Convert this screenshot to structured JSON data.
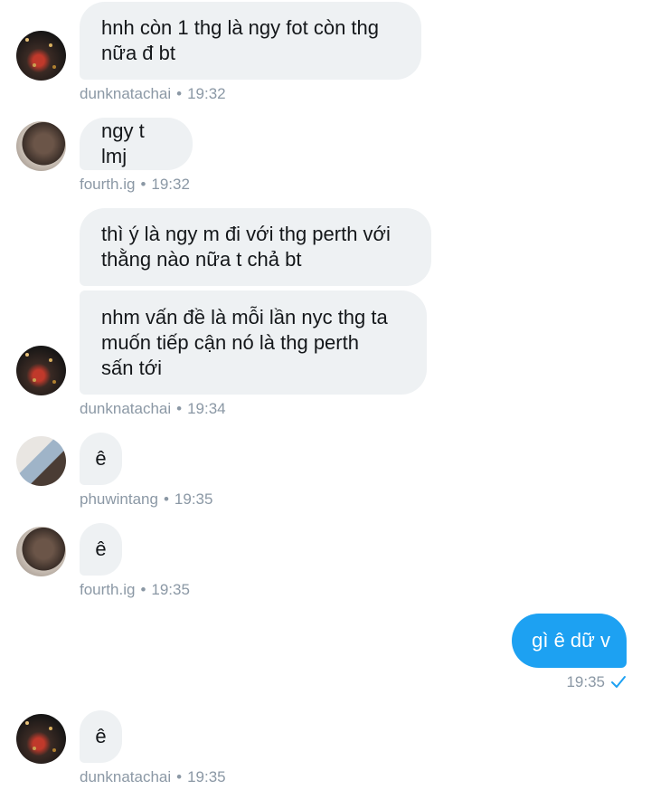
{
  "messages": [
    {
      "user": "dunknatachai",
      "text": "hnh còn 1 thg là ngy fot còn thg\nnữa đ bt",
      "time": "19:32"
    },
    {
      "user": "fourth.ig",
      "text": "ngy t lmj",
      "time": "19:32"
    },
    {
      "user": "dunknatachai",
      "text": "thì ý là ngy m đi với thg perth với\nthằng nào nữa t chả bt",
      "text2": "nhm vấn đề là mỗi lần nyc thg ta\nmuốn tiếp cận nó là thg perth\nsấn tới",
      "time": "19:34"
    },
    {
      "user": "phuwintang",
      "text": "ê",
      "time": "19:35"
    },
    {
      "user": "fourth.ig",
      "text": "ê",
      "time": "19:35"
    },
    {
      "user": "dunknatachai",
      "text": "ê",
      "time": "19:35"
    }
  ],
  "own_message": {
    "text": "gì ê dữ v",
    "time": "19:35",
    "status_icon": "checkmark-icon",
    "color": "#1da1f2"
  },
  "separator": "•"
}
